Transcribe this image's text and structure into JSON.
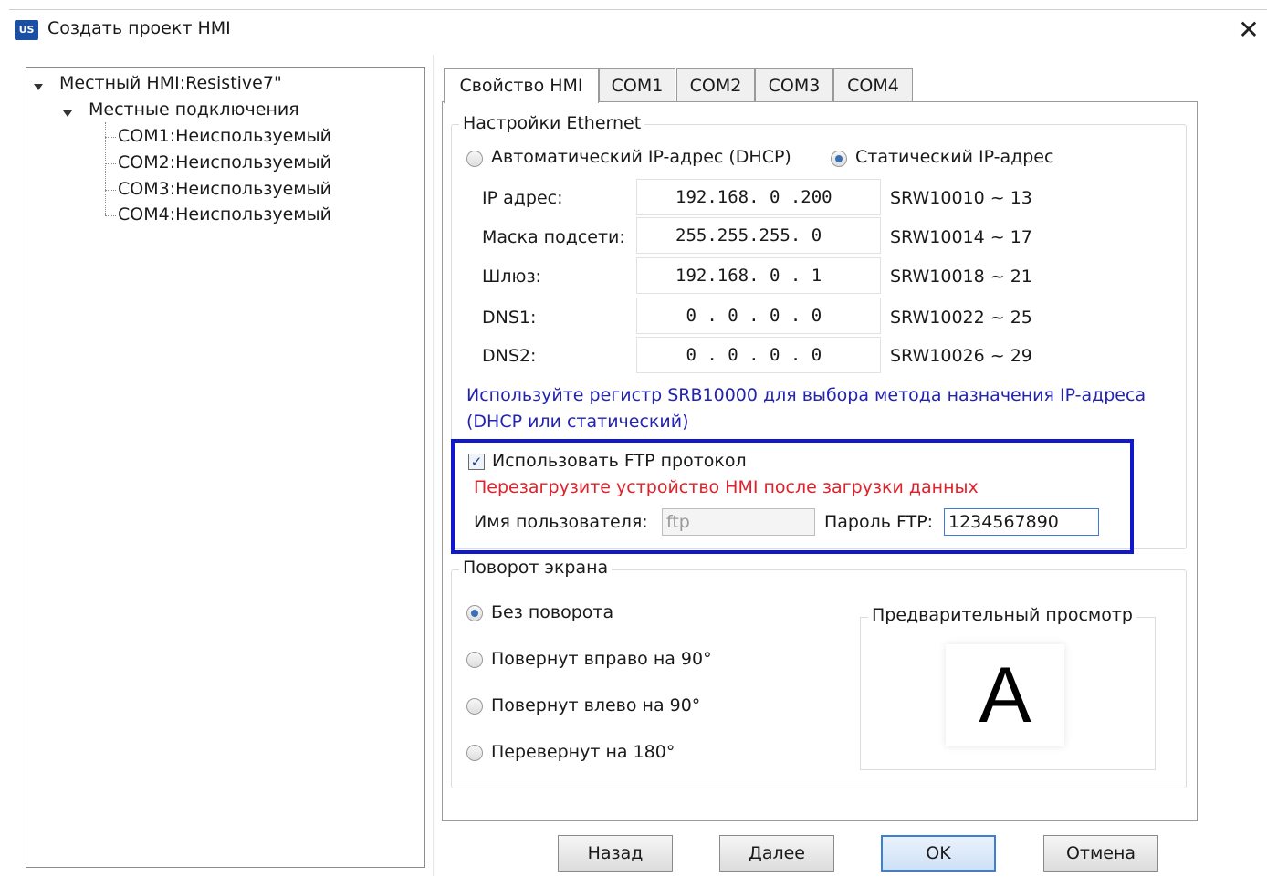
{
  "window": {
    "app_icon": "US",
    "title": "Создать проект HMI",
    "close_glyph": "✕"
  },
  "tree": {
    "root": "Местный HMI:Resistive7\"",
    "group": "Местные подключения",
    "items": [
      "COM1:Неиспользуемый",
      "COM2:Неиспользуемый",
      "COM3:Неиспользуемый",
      "COM4:Неиспользуемый"
    ]
  },
  "tabs": [
    {
      "label": "Свойство HMI",
      "active": true
    },
    {
      "label": "COM1",
      "active": false
    },
    {
      "label": "COM2",
      "active": false
    },
    {
      "label": "COM3",
      "active": false
    },
    {
      "label": "COM4",
      "active": false
    }
  ],
  "ethernet": {
    "title": "Настройки Ethernet",
    "dhcp_label": "Автоматический IP-адрес (DHCP)",
    "static_label": "Статический IP-адрес",
    "selected": "static",
    "rows": [
      {
        "label": "IP адрес:",
        "value": "192.168. 0 .200",
        "register": "SRW10010 ~ 13"
      },
      {
        "label": "Маска подсети:",
        "value": "255.255.255. 0",
        "register": "SRW10014 ~ 17"
      },
      {
        "label": "Шлюз:",
        "value": "192.168. 0 . 1",
        "register": "SRW10018 ~ 21"
      },
      {
        "label": "DNS1:",
        "value": " 0 . 0 . 0 . 0",
        "register": "SRW10022 ~ 25"
      },
      {
        "label": "DNS2:",
        "value": " 0 . 0 . 0 . 0",
        "register": "SRW10026 ~ 29"
      }
    ],
    "note": "Используйте регистр SRB10000 для выбора метода назначения IP-адреса (DHCP или статический)"
  },
  "ftp": {
    "checkbox_label": "Использовать FTP протокол",
    "checked": true,
    "check_glyph": "✓",
    "warning": "Перезагрузите устройство HMI после загрузки данных",
    "username_label": "Имя пользователя:",
    "username_value": "ftp",
    "password_label": "Пароль FTP:",
    "password_value": "1234567890",
    "highlight_color": "#1018cc",
    "warning_color": "#e0202a"
  },
  "rotation": {
    "title": "Поворот экрана",
    "options": [
      "Без поворота",
      "Повернут вправо на 90°",
      "Повернут влево на 90°",
      "Перевернут на 180°"
    ],
    "selected_index": 0,
    "preview_title": "Предварительный просмотр",
    "preview_glyph": "A"
  },
  "buttons": {
    "back": "Назад",
    "next": "Далее",
    "ok": "OK",
    "cancel": "Отмена"
  },
  "colors": {
    "note": "#2323b0",
    "default_button_border": "#3c7fd4"
  }
}
